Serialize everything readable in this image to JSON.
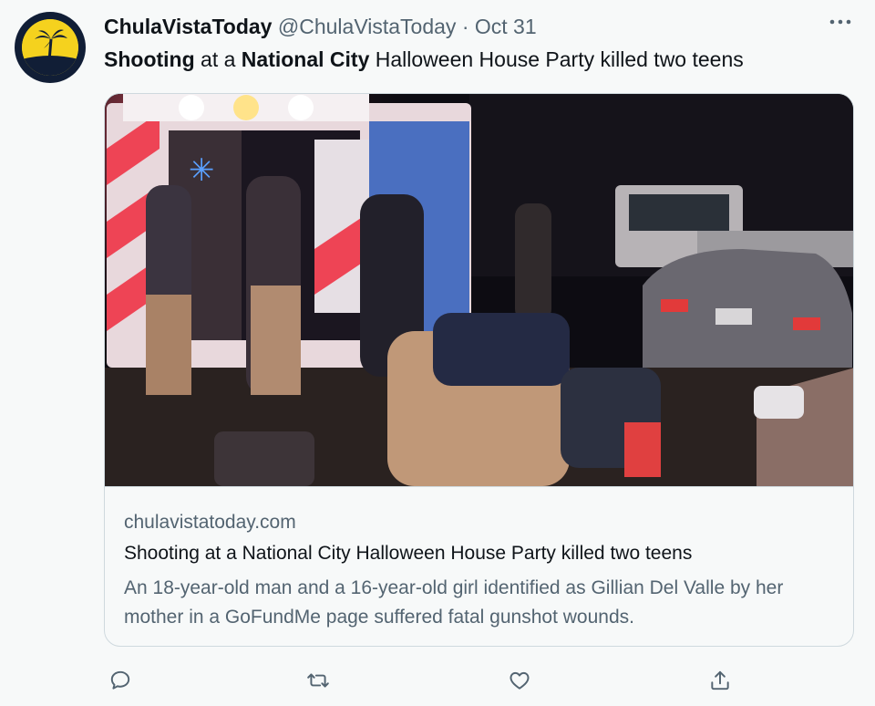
{
  "author": {
    "display_name": "ChulaVistaToday",
    "handle": "@ChulaVistaToday",
    "separator": "·",
    "date": "Oct 31",
    "avatar_icon": "palm-tree-sunset-logo"
  },
  "tweet": {
    "segments": [
      {
        "text": "Shooting",
        "bold": true
      },
      {
        "text": " at a ",
        "bold": false
      },
      {
        "text": "National City",
        "bold": true
      },
      {
        "text": " Halloween House Party killed two teens",
        "bold": false
      }
    ]
  },
  "card": {
    "image_description_icon": "news-photo",
    "domain": "chulavistatoday.com",
    "title": "Shooting at a National City Halloween House Party killed two teens",
    "description": "An 18-year-old man and a 16-year-old girl identified as Gillian Del Valle by her mother in a GoFundMe page suffered fatal gunshot wounds."
  },
  "actions": [
    {
      "icon": "reply-icon"
    },
    {
      "icon": "retweet-icon"
    },
    {
      "icon": "like-icon"
    },
    {
      "icon": "share-icon"
    }
  ],
  "more_icon": "more-options-icon",
  "colors": {
    "background": "#f7f9f9",
    "text_primary": "#0f1419",
    "text_secondary": "#536471",
    "border": "#cfd9de",
    "avatar_bg": "#111e36",
    "avatar_accent": "#f5d21e"
  }
}
